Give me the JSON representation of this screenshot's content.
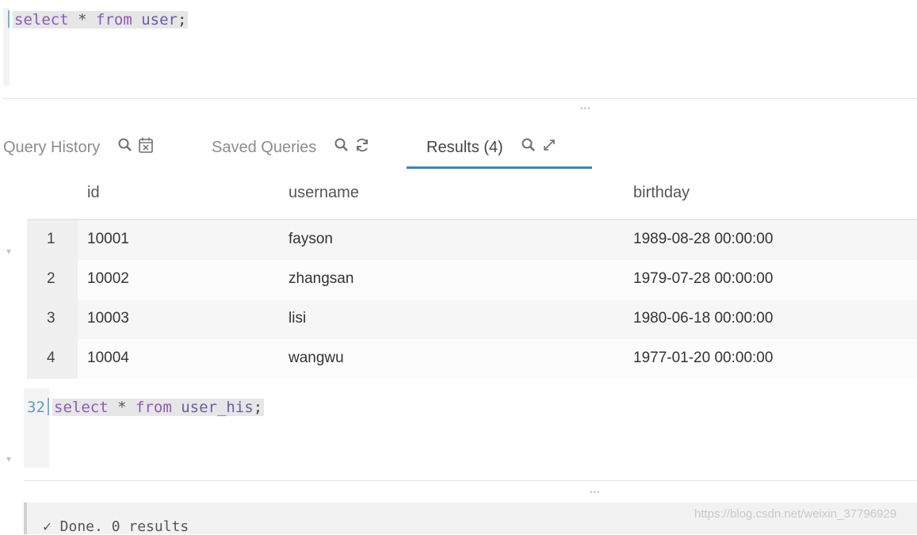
{
  "editor1": {
    "tokens": {
      "kw1": "select",
      "star": "*",
      "kw2": "from",
      "table": "user",
      "end": ";"
    }
  },
  "tabs": [
    {
      "label": "Query History",
      "icons": [
        "search-icon",
        "calendar-clear-icon"
      ]
    },
    {
      "label": "Saved Queries",
      "icons": [
        "search-icon",
        "refresh-icon"
      ]
    },
    {
      "label": "Results (4)",
      "icons": [
        "search-icon",
        "expand-icon"
      ],
      "active": true
    }
  ],
  "results": {
    "columns": [
      "id",
      "username",
      "birthday"
    ],
    "rows": [
      {
        "n": "1",
        "id": "10001",
        "username": "fayson",
        "birthday": "1989-08-28 00:00:00"
      },
      {
        "n": "2",
        "id": "10002",
        "username": "zhangsan",
        "birthday": "1979-07-28 00:00:00"
      },
      {
        "n": "3",
        "id": "10003",
        "username": "lisi",
        "birthday": "1980-06-18 00:00:00"
      },
      {
        "n": "4",
        "id": "10004",
        "username": "wangwu",
        "birthday": "1977-01-20 00:00:00"
      }
    ]
  },
  "editor2": {
    "line_number": "32",
    "tokens": {
      "kw1": "select",
      "star": "*",
      "kw2": "from",
      "table": "user_his",
      "end": ";"
    }
  },
  "status": {
    "text": "✓ Done. 0 results"
  },
  "watermark": "https://blog.csdn.net/weixin_37796929",
  "colors": {
    "accent": "#3a86b1",
    "keyword": "#8a5cb8",
    "line_number": "#5b9bc4"
  }
}
